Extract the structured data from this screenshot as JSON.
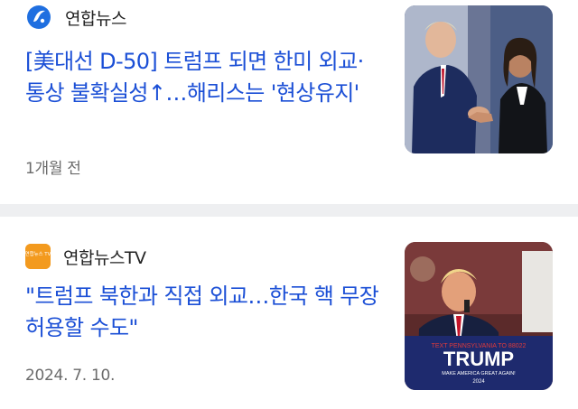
{
  "articles": [
    {
      "source": "연합뉴스",
      "source_icon": "yonhap-logo-icon",
      "headline": "[美대선 D-50] 트럼프 되면 한미 외교·통상 불확실성↑…해리스는 '현상유지'",
      "time": "1개월 전",
      "thumbnail": "trump-harris-handshake-photo"
    },
    {
      "source": "연합뉴스TV",
      "source_icon": "yonhap-tv-logo-icon",
      "logo_text": "연합뉴스 TV",
      "headline": "\"트럼프 북한과 직접 외교…한국 핵 무장 허용할 수도\"",
      "time": "2024. 7. 10.",
      "thumbnail": "trump-rally-photo",
      "sign": {
        "top": "TEXT PENNSYLVANIA TO 88022",
        "main": "TRUMP",
        "sub": "MAKE AMERICA GREAT AGAIN!",
        "year": "2024"
      }
    }
  ],
  "colors": {
    "headline": "#1b4fd6",
    "divider": "#eeeff1",
    "tv_logo": "#f39a1e"
  }
}
